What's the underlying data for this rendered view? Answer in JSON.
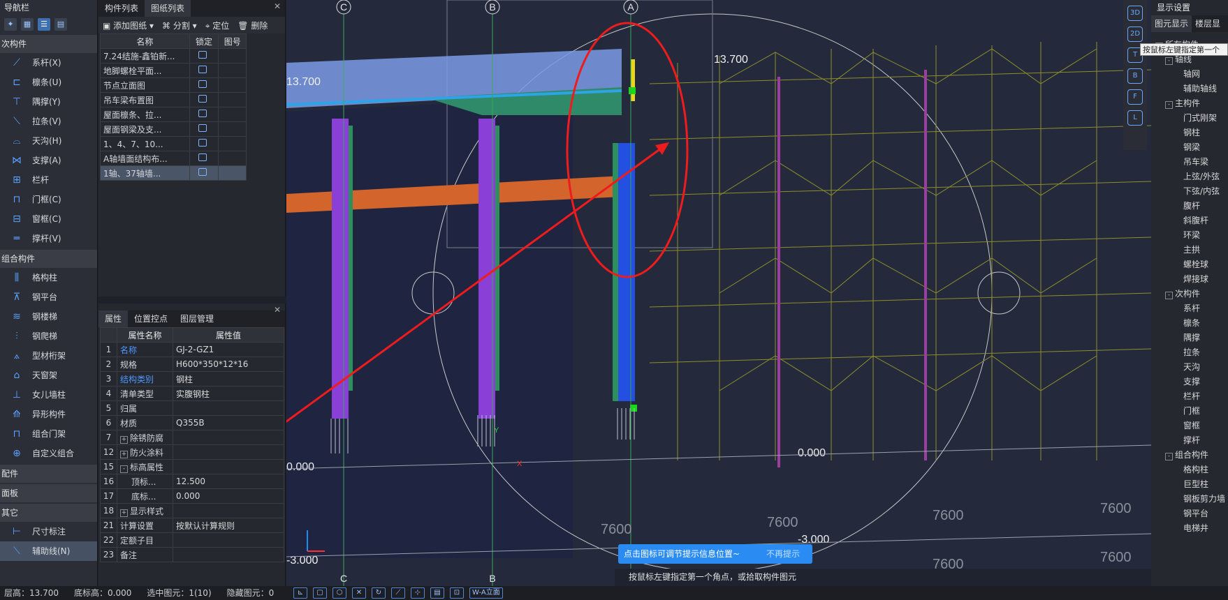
{
  "nav": {
    "title": "导航栏",
    "sections": [
      {
        "label": "次构件",
        "items": [
          {
            "label": "系杆(X)",
            "icon": "tie-rod-icon"
          },
          {
            "label": "檩条(U)",
            "icon": "purlin-icon"
          },
          {
            "label": "隅撑(Y)",
            "icon": "knee-brace-icon"
          },
          {
            "label": "拉条(V)",
            "icon": "sag-rod-icon"
          },
          {
            "label": "天沟(H)",
            "icon": "gutter-icon"
          },
          {
            "label": "支撑(A)",
            "icon": "bracing-icon"
          },
          {
            "label": "栏杆",
            "icon": "railing-icon"
          },
          {
            "label": "门框(C)",
            "icon": "door-frame-icon"
          },
          {
            "label": "窗框(C)",
            "icon": "window-frame-icon"
          },
          {
            "label": "撑杆(V)",
            "icon": "strut-icon"
          }
        ]
      },
      {
        "label": "组合构件",
        "items": [
          {
            "label": "格构柱",
            "icon": "lattice-column-icon"
          },
          {
            "label": "钢平台",
            "icon": "steel-platform-icon"
          },
          {
            "label": "钢楼梯",
            "icon": "steel-stair-icon"
          },
          {
            "label": "钢爬梯",
            "icon": "steel-ladder-icon"
          },
          {
            "label": "型材桁架",
            "icon": "truss-icon"
          },
          {
            "label": "天窗架",
            "icon": "skylight-frame-icon"
          },
          {
            "label": "女儿墙柱",
            "icon": "parapet-column-icon"
          },
          {
            "label": "异形构件",
            "icon": "special-shape-icon"
          },
          {
            "label": "组合门架",
            "icon": "combo-door-frame-icon"
          },
          {
            "label": "自定义组合",
            "icon": "custom-combo-icon"
          }
        ]
      },
      {
        "label": "配件",
        "items": []
      },
      {
        "label": "面板",
        "items": []
      },
      {
        "label": "其它",
        "items": [
          {
            "label": "尺寸标注",
            "icon": "dimension-icon"
          },
          {
            "label": "辅助线(N)",
            "icon": "aux-line-icon",
            "selected": true
          }
        ]
      }
    ]
  },
  "complist": {
    "tabs": [
      "构件列表",
      "图纸列表"
    ],
    "toolbar": {
      "add": "添加图纸",
      "split": "分割",
      "locate": "定位",
      "delete": "删除"
    },
    "headers": {
      "name": "名称",
      "lock": "锁定",
      "sheet": "图号"
    },
    "rows": [
      {
        "name": "7.24结施-鑫铂新..."
      },
      {
        "name": "地脚螺栓平面..."
      },
      {
        "name": "节点立面图"
      },
      {
        "name": "吊车梁布置图"
      },
      {
        "name": "屋面檩条、拉..."
      },
      {
        "name": "屋面钢梁及支..."
      },
      {
        "name": "1、4、7、10..."
      },
      {
        "name": "A轴墙面结构布..."
      },
      {
        "name": "1轴、37轴墙..."
      }
    ]
  },
  "props": {
    "tabs": [
      "属性",
      "位置控点",
      "图层管理"
    ],
    "headers": {
      "name": "属性名称",
      "value": "属性值"
    },
    "rows": [
      {
        "num": "1",
        "name": "名称",
        "value": "GJ-2-GZ1",
        "blue": true
      },
      {
        "num": "2",
        "name": "规格",
        "value": "H600*350*12*16"
      },
      {
        "num": "3",
        "name": "结构类别",
        "value": "钢柱",
        "blue": true
      },
      {
        "num": "4",
        "name": "清单类型",
        "value": "实腹钢柱"
      },
      {
        "num": "5",
        "name": "归属",
        "value": ""
      },
      {
        "num": "6",
        "name": "材质",
        "value": "Q355B"
      },
      {
        "num": "7",
        "name": "除锈防腐",
        "value": "",
        "exp": "+"
      },
      {
        "num": "12",
        "name": "防火涂料",
        "value": "",
        "exp": "+"
      },
      {
        "num": "15",
        "name": "标高属性",
        "value": "",
        "exp": "-"
      },
      {
        "num": "16",
        "name": "顶标...",
        "value": "12.500",
        "indent": true
      },
      {
        "num": "17",
        "name": "底标...",
        "value": "0.000",
        "indent": true
      },
      {
        "num": "18",
        "name": "显示样式",
        "value": "",
        "exp": "+"
      },
      {
        "num": "21",
        "name": "计算设置",
        "value": "按默认计算规则"
      },
      {
        "num": "22",
        "name": "定额子目",
        "value": ""
      },
      {
        "num": "23",
        "name": "备注",
        "value": ""
      }
    ]
  },
  "viewport": {
    "axes": [
      "C",
      "B",
      "A"
    ],
    "elevations": {
      "top": "13.700",
      "top_right": "13.700",
      "zero_left": "0.000",
      "zero_right": "0.000",
      "minus_left": "-3.000",
      "minus_right": "-3.000"
    },
    "spans": [
      "7600",
      "7600",
      "7600",
      "7600",
      "7600",
      "7600"
    ],
    "axis_marks": {
      "x": "X",
      "y": "Y"
    }
  },
  "vtools": [
    "3D",
    "2D",
    "T",
    "B",
    "F",
    "L"
  ],
  "disp": {
    "title": "显示设置",
    "tabs": [
      "图元显示",
      "楼层显"
    ],
    "tooltip": "按鼠标左键指定第一个",
    "tree": [
      {
        "label": "所有构件",
        "level": 0,
        "exp": "-"
      },
      {
        "label": "轴线",
        "level": 1,
        "exp": "-"
      },
      {
        "label": "轴网",
        "level": 2
      },
      {
        "label": "辅助轴线",
        "level": 2
      },
      {
        "label": "主构件",
        "level": 1,
        "exp": "-"
      },
      {
        "label": "门式刚架",
        "level": 2
      },
      {
        "label": "钢柱",
        "level": 2
      },
      {
        "label": "钢梁",
        "level": 2
      },
      {
        "label": "吊车梁",
        "level": 2
      },
      {
        "label": "上弦/外弦",
        "level": 2
      },
      {
        "label": "下弦/内弦",
        "level": 2
      },
      {
        "label": "腹杆",
        "level": 2
      },
      {
        "label": "斜腹杆",
        "level": 2
      },
      {
        "label": "环梁",
        "level": 2
      },
      {
        "label": "主拱",
        "level": 2
      },
      {
        "label": "螺栓球",
        "level": 2
      },
      {
        "label": "焊接球",
        "level": 2
      },
      {
        "label": "次构件",
        "level": 1,
        "exp": "-"
      },
      {
        "label": "系杆",
        "level": 2
      },
      {
        "label": "檩条",
        "level": 2
      },
      {
        "label": "隅撑",
        "level": 2
      },
      {
        "label": "拉条",
        "level": 2
      },
      {
        "label": "天沟",
        "level": 2
      },
      {
        "label": "支撑",
        "level": 2
      },
      {
        "label": "栏杆",
        "level": 2
      },
      {
        "label": "门框",
        "level": 2
      },
      {
        "label": "窗框",
        "level": 2
      },
      {
        "label": "撑杆",
        "level": 2
      },
      {
        "label": "组合构件",
        "level": 1,
        "exp": "-"
      },
      {
        "label": "格构柱",
        "level": 2
      },
      {
        "label": "巨型柱",
        "level": 2
      },
      {
        "label": "钢板剪力墙",
        "level": 2
      },
      {
        "label": "钢平台",
        "level": 2
      },
      {
        "label": "电梯井",
        "level": 2
      }
    ]
  },
  "hint": {
    "text": "点击图标可调节提示信息位置~",
    "dismiss": "不再提示"
  },
  "cmdline": {
    "text": "按鼠标左键指定第一个角点，或拾取构件图元"
  },
  "status": {
    "layer_height": "层高：13.700",
    "bottom_height": "底标高：0.000",
    "selected": "选中图元：1(10)",
    "hidden": "隐藏图元：0"
  },
  "bottombar": {
    "view_select": "W-A立面"
  }
}
